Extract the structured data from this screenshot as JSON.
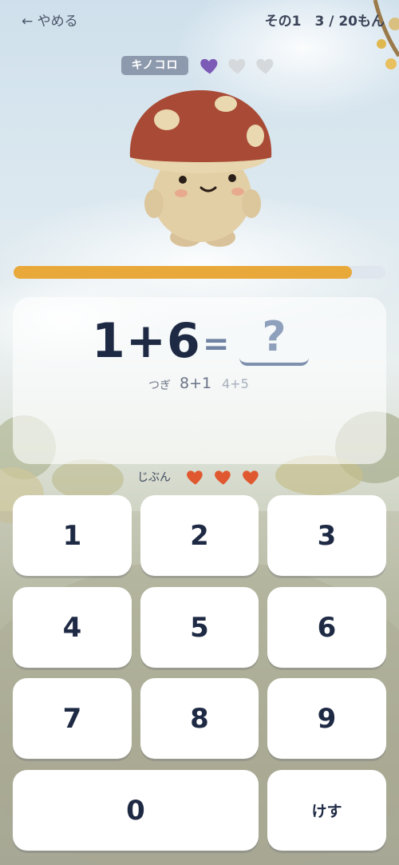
{
  "topbar": {
    "back_label": "← やめる",
    "progress": "その1　3 / 20もん"
  },
  "enemy": {
    "name": "キノコロ",
    "hearts_total": 3,
    "hearts_remaining": 1,
    "heart_color": "#7b5bb5",
    "heart_empty_color": "#d6d9dc"
  },
  "progress_fraction": 0.91,
  "progress_color": "#e9a93a",
  "question": {
    "problem": "1+6",
    "equals": "=",
    "answer_placeholder": "?",
    "next_label": "つぎ",
    "next_items": [
      "8+1",
      "4+5"
    ]
  },
  "player": {
    "label": "じぶん",
    "hearts": 3,
    "heart_color": "#e0582f"
  },
  "keypad": {
    "k1": "1",
    "k2": "2",
    "k3": "3",
    "k4": "4",
    "k5": "5",
    "k6": "6",
    "k7": "7",
    "k8": "8",
    "k9": "9",
    "k0": "0",
    "erase": "けす"
  }
}
